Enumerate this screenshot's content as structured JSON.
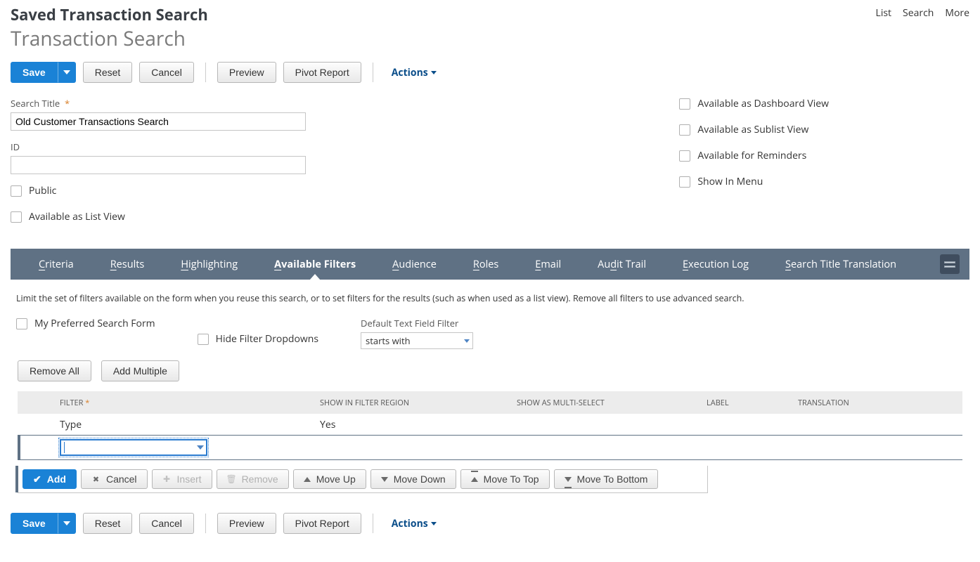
{
  "header": {
    "supertitle": "Saved Transaction Search",
    "title": "Transaction Search",
    "top_links": [
      "List",
      "Search",
      "More"
    ]
  },
  "toolbar": {
    "save": "Save",
    "reset": "Reset",
    "cancel": "Cancel",
    "preview": "Preview",
    "pivot": "Pivot Report",
    "actions": "Actions"
  },
  "form": {
    "search_title_label": "Search Title",
    "search_title_value": "Old Customer Transactions Search",
    "id_label": "ID",
    "id_value": "",
    "left_checks": [
      "Public",
      "Available as List View"
    ],
    "right_checks": [
      "Available as Dashboard View",
      "Available as Sublist View",
      "Available for Reminders",
      "Show In Menu"
    ]
  },
  "tabs": [
    "Criteria",
    "Results",
    "Highlighting",
    "Available Filters",
    "Audience",
    "Roles",
    "Email",
    "Audit Trail",
    "Execution Log",
    "Search Title Translation"
  ],
  "active_tab": "Available Filters",
  "tab_ul_idx": [
    0,
    0,
    0,
    0,
    0,
    0,
    0,
    2,
    0,
    0
  ],
  "panel": {
    "hint": "Limit the set of filters available on the form when you reuse this search, or to set filters for the results (such as when used as a list view). Remove all filters to use advanced search.",
    "pref_label": "My Preferred Search Form",
    "hide_dd_label": "Hide Filter Dropdowns",
    "default_text_filter_label": "Default Text Field Filter",
    "default_text_filter_value": "starts with",
    "remove_all": "Remove All",
    "add_multiple": "Add Multiple",
    "columns": {
      "filter": "FILTER",
      "region": "SHOW IN FILTER REGION",
      "multi": "SHOW AS MULTI-SELECT",
      "label": "LABEL",
      "trans": "TRANSLATION"
    },
    "rows": [
      {
        "filter": "Type",
        "region": "Yes",
        "multi": "",
        "label": "",
        "trans": ""
      }
    ],
    "actions": {
      "add": "Add",
      "cancel": "Cancel",
      "insert": "Insert",
      "remove": "Remove",
      "up": "Move Up",
      "down": "Move Down",
      "top": "Move To Top",
      "bottom": "Move To Bottom"
    }
  }
}
